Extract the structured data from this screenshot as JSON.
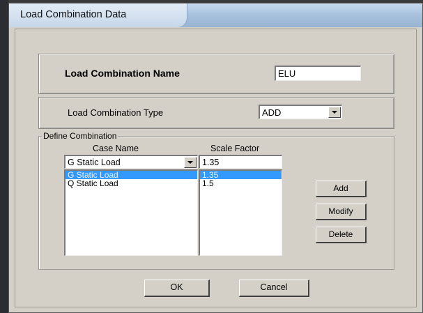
{
  "window": {
    "title": "Load Combination Data"
  },
  "combination_name": {
    "label": "Load Combination Name",
    "value": "ELU"
  },
  "combination_type": {
    "label": "Load Combination Type",
    "selected": "ADD"
  },
  "define": {
    "group_label": "Define Combination",
    "case_name_header": "Case Name",
    "scale_factor_header": "Scale Factor",
    "case_select": "G Static Load",
    "scale_input": "1.35",
    "cases": [
      {
        "name": "G Static Load",
        "factor": "1.35",
        "selected": true
      },
      {
        "name": "Q Static Load",
        "factor": "1.5",
        "selected": false
      }
    ],
    "add_label": "Add",
    "modify_label": "Modify",
    "delete_label": "Delete"
  },
  "footer": {
    "ok_label": "OK",
    "cancel_label": "Cancel"
  },
  "colors": {
    "selection": "#3399ff",
    "dialog_face": "#d4d0c8",
    "title_gradient": "#a9c3de"
  }
}
